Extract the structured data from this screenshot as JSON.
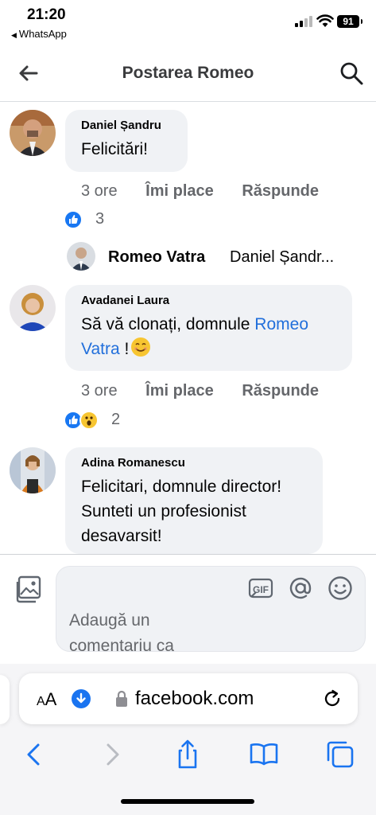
{
  "status_bar": {
    "time": "21:20",
    "back_app": "WhatsApp",
    "battery": "91"
  },
  "header": {
    "title": "Postarea Romeo"
  },
  "comments": [
    {
      "name": "Daniel Șandru",
      "text": "Felicitări!",
      "time": "3 ore",
      "like_label": "Îmi place",
      "reply_label": "Răspunde",
      "reaction_count": "3",
      "reply_preview": {
        "name": "Romeo Vatra",
        "text": "Daniel Șandr..."
      }
    },
    {
      "name": "Avadanei Laura",
      "text_before": "Să vă clonați, domnule ",
      "mention_1": "Romeo",
      "mention_2": "Vatra",
      "text_after": " !",
      "emoji": "😊",
      "time": "3 ore",
      "like_label": "Îmi place",
      "reply_label": "Răspunde",
      "reaction_count": "2"
    },
    {
      "name": "Adina Romanescu",
      "line1": "Felicitari, domnule director!",
      "line2": "Sunteti un profesionist",
      "line3": "desavarsit!"
    }
  ],
  "composer": {
    "placeholder_line1": "Adaugă un",
    "placeholder_line2": "comentariu ca",
    "gif_label": "GIF"
  },
  "browser": {
    "aa_label_small": "A",
    "aa_label_big": "A",
    "url": "facebook.com"
  },
  "colors": {
    "link": "#216fdb",
    "like_blue": "#1877f2",
    "bubble_bg": "#f0f2f5",
    "meta_gray": "#65676b"
  }
}
